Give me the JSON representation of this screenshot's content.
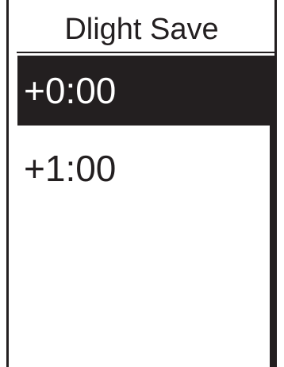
{
  "screen": {
    "title": "Dlight Save"
  },
  "options": [
    {
      "label": "+0:00",
      "selected": true
    },
    {
      "label": "+1:00",
      "selected": false
    }
  ],
  "colors": {
    "foreground": "#231f20",
    "background": "#ffffff",
    "selected_background": "#231f20",
    "selected_text": "#ffffff"
  }
}
